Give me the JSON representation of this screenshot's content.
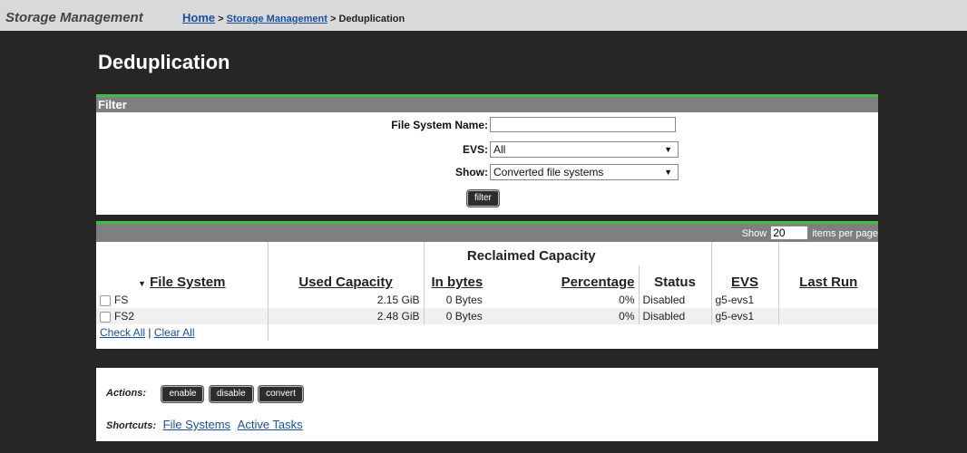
{
  "app": {
    "title": "Storage Management"
  },
  "breadcrumb": {
    "home": "Home",
    "sep1": " > ",
    "storage": "Storage Management",
    "sep2": " > ",
    "current": "Deduplication"
  },
  "page": {
    "title": "Deduplication"
  },
  "filter": {
    "header": "Filter",
    "fs_name_label": "File System Name:",
    "fs_name_value": "",
    "evs_label": "EVS:",
    "evs_value": "All",
    "show_label": "Show:",
    "show_value": "Converted file systems",
    "filter_button": "filter"
  },
  "table": {
    "show_label": "Show",
    "per_page_value": "20",
    "per_page_label": "items per page",
    "group_header": "Reclaimed Capacity",
    "headers": {
      "file_system": "File System",
      "used_capacity": "Used Capacity",
      "in_bytes": "In bytes",
      "percentage": "Percentage",
      "status": "Status",
      "evs": "EVS",
      "last_run": "Last Run"
    },
    "rows": [
      {
        "name": "FS",
        "used": "2.15 GiB",
        "bytes": "0 Bytes",
        "pct": "0%",
        "status": "Disabled",
        "evs": "g5-evs1",
        "last_run": ""
      },
      {
        "name": "FS2",
        "used": "2.48 GiB",
        "bytes": "0 Bytes",
        "pct": "0%",
        "status": "Disabled",
        "evs": "g5-evs1",
        "last_run": ""
      }
    ],
    "check_all": "Check All",
    "divider": " | ",
    "clear_all": "Clear All"
  },
  "actions": {
    "label": "Actions:",
    "enable": "enable",
    "disable": "disable",
    "convert": "convert",
    "shortcuts_label": "Shortcuts:",
    "shortcut_fs": "File Systems",
    "shortcut_tasks": "Active Tasks"
  },
  "colors": {
    "accent": "#3fbf3f",
    "header_bg": "#7f7f7f",
    "page_bg": "#262626",
    "link": "#1a4f9c"
  }
}
